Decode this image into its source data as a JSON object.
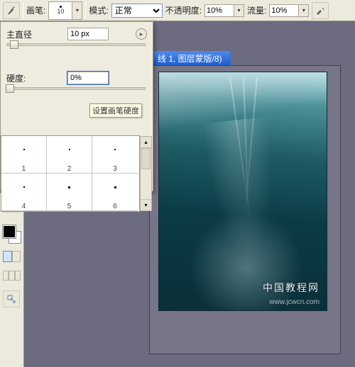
{
  "optbar": {
    "brush_label": "画笔:",
    "brush_size_under": "10",
    "mode_label": "模式:",
    "mode_value": "正常",
    "opacity_label": "不透明度:",
    "opacity_value": "10%",
    "flow_label": "流量:",
    "flow_value": "10%"
  },
  "brush_popup": {
    "master_diameter_label": "主直径",
    "master_diameter_value": "10 px",
    "hardness_label": "硬度:",
    "hardness_value": "0%",
    "tooltip": "设置画笔硬度",
    "presets": [
      {
        "id": "1"
      },
      {
        "id": "2"
      },
      {
        "id": "3"
      },
      {
        "id": "4"
      },
      {
        "id": "5"
      },
      {
        "id": "6"
      }
    ]
  },
  "document": {
    "title_fragment": "线 1, 图层蒙版/8)"
  },
  "watermark": {
    "line1": "中国教程网",
    "line2": "www.jcwcn.com"
  },
  "colors": {
    "panel_bg": "#eeecdf",
    "titlebar": "#2a6cdc"
  }
}
